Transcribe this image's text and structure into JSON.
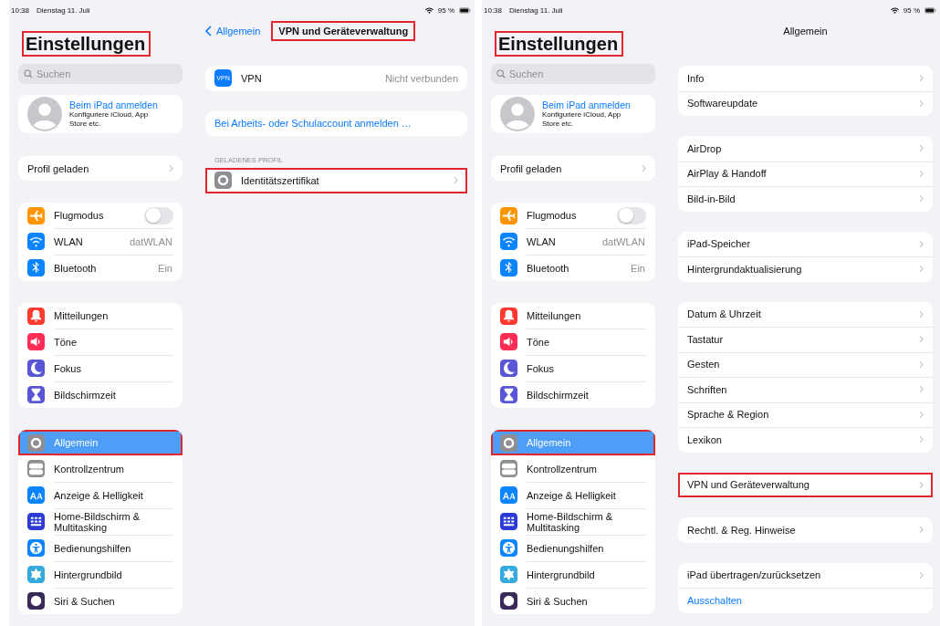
{
  "panels": [
    {
      "status_bar": {
        "time": "10:38",
        "date": "Dienstag 11. Juli",
        "battery": "95 %"
      },
      "sidebar": {
        "title": "Einstellungen",
        "title_annotated": true,
        "search": {
          "placeholder": "Suchen"
        },
        "account": {
          "name": "Beim iPad anmelden",
          "subtitle": "Konfiguriere iCloud, App Store etc."
        },
        "profile": "Profil geladen",
        "groups": [
          [
            {
              "label": "Flugmodus",
              "kind": "toggle",
              "on": false,
              "selected": false,
              "annotated": false,
              "color": "#ff9500"
            },
            {
              "label": "WLAN",
              "kind": "value",
              "value": "datWLAN",
              "selected": false,
              "annotated": false,
              "color": "#0a84ff"
            },
            {
              "label": "Bluetooth",
              "kind": "value",
              "value": "Ein",
              "selected": false,
              "annotated": false,
              "color": "#0a84ff"
            }
          ],
          [
            {
              "label": "Mitteilungen",
              "kind": "plain",
              "selected": false,
              "annotated": false,
              "color": "#ff3b30"
            },
            {
              "label": "Töne",
              "kind": "plain",
              "selected": false,
              "annotated": false,
              "color": "#ff2d55"
            },
            {
              "label": "Fokus",
              "kind": "plain",
              "selected": false,
              "annotated": false,
              "color": "#5856d6"
            },
            {
              "label": "Bildschirmzeit",
              "kind": "plain",
              "selected": false,
              "annotated": false,
              "color": "#5856d6"
            }
          ],
          [
            {
              "label": "Allgemein",
              "kind": "plain",
              "selected": true,
              "annotated": true,
              "color": "#8e8e93"
            },
            {
              "label": "Kontrollzentrum",
              "kind": "plain",
              "selected": false,
              "annotated": false,
              "color": "#8e8e93"
            },
            {
              "label": "Anzeige & Helligkeit",
              "kind": "plain",
              "selected": false,
              "annotated": false,
              "color": "#0a84ff"
            },
            {
              "label": "Home-Bildschirm & Multitasking",
              "kind": "plain",
              "selected": false,
              "annotated": false,
              "color": "#2c3bd6"
            },
            {
              "label": "Bedienungshilfen",
              "kind": "plain",
              "selected": false,
              "annotated": false,
              "color": "#0a84ff"
            },
            {
              "label": "Hintergrundbild",
              "kind": "plain",
              "selected": false,
              "annotated": false,
              "color": "#35aadc"
            },
            {
              "label": "Siri & Suchen",
              "kind": "plain",
              "selected": false,
              "annotated": false,
              "color": "#3a2a5a"
            }
          ]
        ]
      },
      "detail": {
        "back": "Allgemein",
        "title": "VPN und Geräteverwaltung",
        "title_annotated": true,
        "groups": [
          {
            "rows": [
              {
                "kind": "vpn",
                "badge": "VPN",
                "label": "VPN",
                "value": "Nicht verbunden",
                "annotated": false
              }
            ]
          },
          {
            "rows": [
              {
                "kind": "link",
                "label": "Bei Arbeits- oder Schulaccount anmelden …",
                "annotated": false
              }
            ]
          },
          {
            "header": "GELADENES PROFIL",
            "rows": [
              {
                "kind": "gear",
                "label": "Identitätszertifikat",
                "annotated": true
              }
            ]
          }
        ]
      }
    },
    {
      "status_bar": {
        "time": "10:38",
        "date": "Dienstag 11. Juli",
        "battery": "95 %"
      },
      "sidebar": {
        "title": "Einstellungen",
        "title_annotated": true,
        "search": {
          "placeholder": "Suchen"
        },
        "account": {
          "name": "Beim iPad anmelden",
          "subtitle": "Konfiguriere iCloud, App Store etc."
        },
        "profile": "Profil geladen",
        "groups": [
          [
            {
              "label": "Flugmodus",
              "kind": "toggle",
              "on": false,
              "selected": false,
              "annotated": false,
              "color": "#ff9500"
            },
            {
              "label": "WLAN",
              "kind": "value",
              "value": "datWLAN",
              "selected": false,
              "annotated": false,
              "color": "#0a84ff"
            },
            {
              "label": "Bluetooth",
              "kind": "value",
              "value": "Ein",
              "selected": false,
              "annotated": false,
              "color": "#0a84ff"
            }
          ],
          [
            {
              "label": "Mitteilungen",
              "kind": "plain",
              "selected": false,
              "annotated": false,
              "color": "#ff3b30"
            },
            {
              "label": "Töne",
              "kind": "plain",
              "selected": false,
              "annotated": false,
              "color": "#ff2d55"
            },
            {
              "label": "Fokus",
              "kind": "plain",
              "selected": false,
              "annotated": false,
              "color": "#5856d6"
            },
            {
              "label": "Bildschirmzeit",
              "kind": "plain",
              "selected": false,
              "annotated": false,
              "color": "#5856d6"
            }
          ],
          [
            {
              "label": "Allgemein",
              "kind": "plain",
              "selected": true,
              "annotated": true,
              "color": "#8e8e93"
            },
            {
              "label": "Kontrollzentrum",
              "kind": "plain",
              "selected": false,
              "annotated": false,
              "color": "#8e8e93"
            },
            {
              "label": "Anzeige & Helligkeit",
              "kind": "plain",
              "selected": false,
              "annotated": false,
              "color": "#0a84ff"
            },
            {
              "label": "Home-Bildschirm & Multitasking",
              "kind": "plain",
              "selected": false,
              "annotated": false,
              "color": "#2c3bd6"
            },
            {
              "label": "Bedienungshilfen",
              "kind": "plain",
              "selected": false,
              "annotated": false,
              "color": "#0a84ff"
            },
            {
              "label": "Hintergrundbild",
              "kind": "plain",
              "selected": false,
              "annotated": false,
              "color": "#35aadc"
            },
            {
              "label": "Siri & Suchen",
              "kind": "plain",
              "selected": false,
              "annotated": false,
              "color": "#3a2a5a"
            }
          ]
        ]
      },
      "detail": {
        "title": "Allgemein",
        "title_annotated": false,
        "groups": [
          {
            "rows": [
              {
                "kind": "nav",
                "label": "Info",
                "annotated": false
              },
              {
                "kind": "nav",
                "label": "Softwareupdate",
                "annotated": false
              }
            ]
          },
          {
            "rows": [
              {
                "kind": "nav",
                "label": "AirDrop",
                "annotated": false
              },
              {
                "kind": "nav",
                "label": "AirPlay & Handoff",
                "annotated": false
              },
              {
                "kind": "nav",
                "label": "Bild-in-Bild",
                "annotated": false
              }
            ]
          },
          {
            "rows": [
              {
                "kind": "nav",
                "label": "iPad-Speicher",
                "annotated": false
              },
              {
                "kind": "nav",
                "label": "Hintergrundaktualisierung",
                "annotated": false
              }
            ]
          },
          {
            "rows": [
              {
                "kind": "nav",
                "label": "Datum & Uhrzeit",
                "annotated": false
              },
              {
                "kind": "nav",
                "label": "Tastatur",
                "annotated": false
              },
              {
                "kind": "nav",
                "label": "Gesten",
                "annotated": false
              },
              {
                "kind": "nav",
                "label": "Schriften",
                "annotated": false
              },
              {
                "kind": "nav",
                "label": "Sprache & Region",
                "annotated": false
              },
              {
                "kind": "nav",
                "label": "Lexikon",
                "annotated": false
              }
            ]
          },
          {
            "rows": [
              {
                "kind": "nav",
                "label": "VPN und Geräteverwaltung",
                "annotated": true
              }
            ]
          },
          {
            "rows": [
              {
                "kind": "nav",
                "label": "Rechtl. & Reg. Hinweise",
                "annotated": false
              }
            ]
          },
          {
            "rows": [
              {
                "kind": "nav",
                "label": "iPad übertragen/zurücksetzen",
                "annotated": false
              },
              {
                "kind": "link",
                "label": "Ausschalten",
                "annotated": false
              }
            ]
          }
        ]
      }
    }
  ]
}
